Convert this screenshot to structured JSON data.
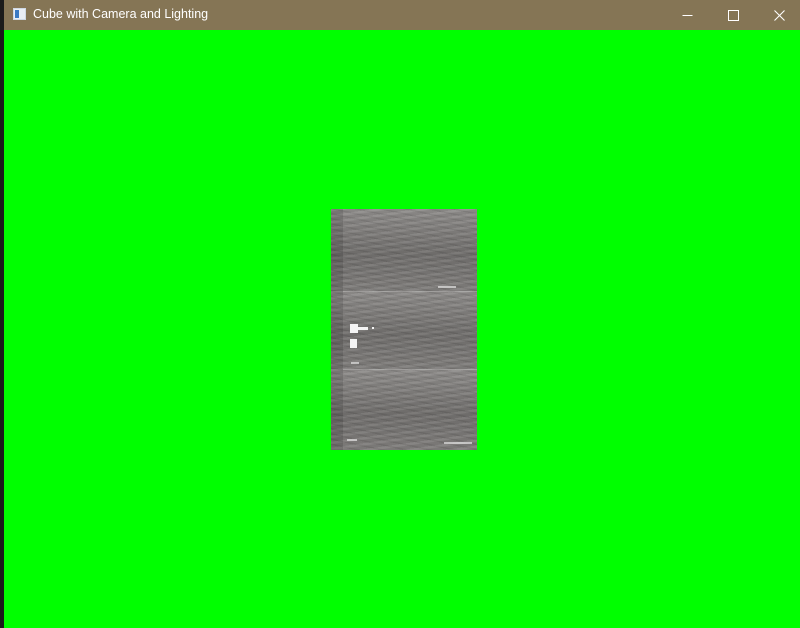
{
  "window": {
    "title": "Cube with Camera and Lighting",
    "icon": "app-window-icon",
    "controls": [
      "minimize-icon",
      "maximize-icon",
      "close-icon"
    ]
  },
  "colors": {
    "titlebar": "#857555",
    "background": "#00ff00",
    "cube_face": "#7a7876"
  }
}
